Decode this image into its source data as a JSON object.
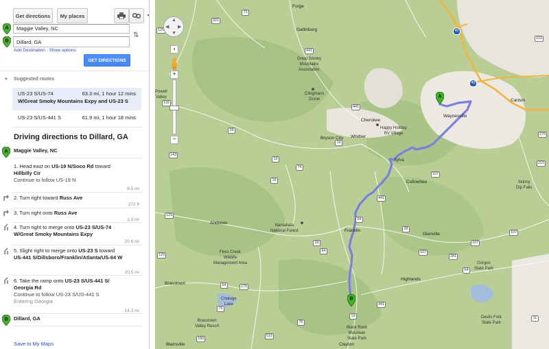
{
  "sidebar": {
    "get_directions_tab": "Get directions",
    "my_places_tab": "My places",
    "start": "Maggie Valley, NC",
    "end": "Dillard, GA",
    "add_destination": "Add Destination",
    "show_options": "Show options",
    "get_directions_button": "GET DIRECTIONS",
    "suggested_heading": "Suggested routes",
    "routes": [
      {
        "name": "US-23 S/US-74",
        "summary": "63.3 mi, 1 hour 12 mins",
        "via": "W/Great Smoky Mountains Expy and US-23 S"
      },
      {
        "name": "US-23 S/US-441 S",
        "summary": "61.9 mi, 1 hour 18 mins"
      }
    ],
    "directions_title": "Driving directions to Dillard, GA",
    "start_label": "Maggie Valley, NC",
    "steps": [
      {
        "num": "1.",
        "pre": "Head east on ",
        "b1": "US-19 N/Soco Rd",
        "mid": " toward ",
        "b2": "Hillbilly Cir",
        "sub": "Continue to follow US-19 N",
        "dist": "6.5 mi"
      },
      {
        "num": "2.",
        "pre": "Turn right toward ",
        "b1": "Russ Ave",
        "dist": "272 ft"
      },
      {
        "num": "3.",
        "pre": "Turn right onto ",
        "b1": "Russ Ave",
        "dist": "1.3 mi"
      },
      {
        "num": "4.",
        "pre": "Turn right to merge onto ",
        "b1": "US-23 S/US-74 W/Great Smoky Mountains Expy",
        "dist": "20.6 mi"
      },
      {
        "num": "5.",
        "pre": "Slight right to merge onto ",
        "b1": "US-23 S",
        "mid": " toward ",
        "b2": "US-441 S/Dillsboro/Franklin/Atlanta/US-64 W",
        "dist": "20.5 mi"
      },
      {
        "num": "6.",
        "pre": "Take the ramp onto ",
        "b1": "US-23 S/US-441 S/ Georgia Rd",
        "sub": "Continue to follow US-23 S/US-441 S",
        "sub2": "Entering Georgia",
        "dist": "14.3 mi"
      }
    ],
    "end_label": "Dillard, GA",
    "save_link": "Save to My Maps"
  },
  "map": {
    "marker_a": "A",
    "marker_b": "B",
    "labels": {
      "forge": "Forge",
      "gatlinburg": "Gatlinburg",
      "gsma": "Great Smoky\nMountains\nAssociation",
      "clingmans": "Clingmans\nDome",
      "bryson": "Bryson City",
      "whittier": "Whittier",
      "cherokee": "Cherokee",
      "happy": "Happy Holiday\nRV Village",
      "waynesville": "Waynesville",
      "canton": "Canton",
      "sylva": "Sylva",
      "cullowhee": "Cullowhee",
      "skinny": "Skinny\nDip Falls",
      "andrews": "Andrews",
      "nantahala": "Nantahala\nNational Forest",
      "franklin": "Franklin",
      "glenville": "Glenville",
      "fires": "Fires Creek\nWildlife\nManagement Area",
      "gorges": "Gorges\nState Park",
      "highlands": "Highlands",
      "brasstown": "Brasstown",
      "chatuge": "Chatuge\nLake",
      "bvresort": "Brasstown\nValley Resort",
      "blackrock": "Black Rock\nMountain\nState Park",
      "devils": "Devils Fork\nState Park",
      "blairsville": "Blairsville",
      "clayton": "Clayton",
      "powell": "Powell\nValley"
    },
    "shields": [
      "441",
      "321",
      "73",
      "129",
      "40",
      "441",
      "19",
      "74",
      "115",
      "28",
      "143",
      "19",
      "441",
      "107",
      "64",
      "28",
      "28",
      "64",
      "129",
      "175",
      "64",
      "76",
      "76",
      "515",
      "19",
      "107",
      "107",
      "11",
      "281",
      "64",
      "276",
      "107",
      "129",
      "180",
      "441",
      "19",
      "215",
      "215",
      "40"
    ]
  },
  "colors": {
    "route": "#7b7fe0",
    "terrain": "#b8cc93",
    "forest": "#a9c486",
    "urban": "#e9e5dc",
    "highway": "#f8c85b"
  }
}
